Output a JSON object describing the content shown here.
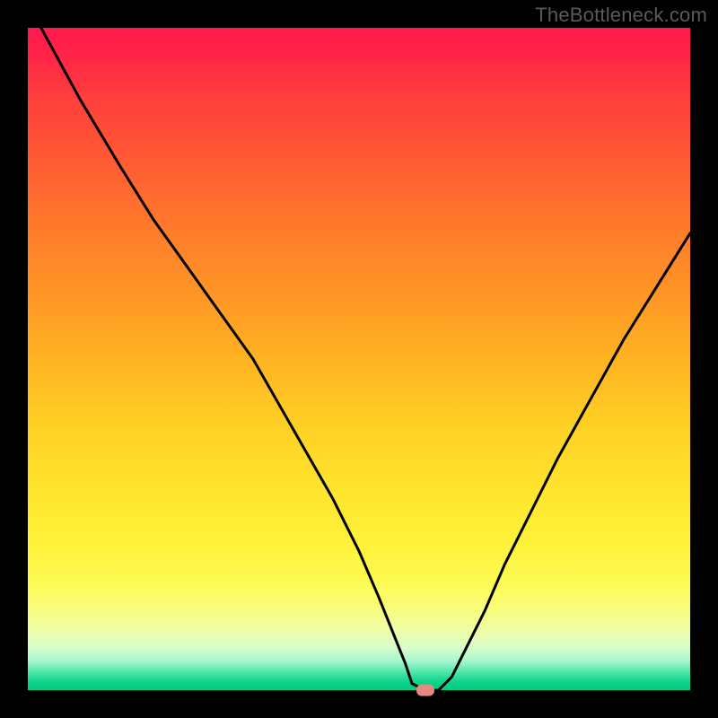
{
  "watermark": "TheBottleneck.com",
  "chart_data": {
    "type": "line",
    "title": "",
    "xlabel": "",
    "ylabel": "",
    "xlim": [
      0,
      100
    ],
    "ylim": [
      0,
      100
    ],
    "x": [
      2,
      8,
      14,
      19,
      24,
      29,
      34,
      38,
      42,
      46,
      50,
      53,
      55,
      57,
      58,
      60,
      62,
      64,
      66,
      69,
      72,
      76,
      80,
      85,
      90,
      95,
      100
    ],
    "y": [
      100,
      89,
      79,
      71,
      64,
      57,
      50,
      43,
      36,
      29,
      21,
      14,
      9,
      4,
      1,
      0,
      0,
      2,
      6,
      12,
      19,
      27,
      35,
      44,
      53,
      61,
      69
    ],
    "minimum_marker": {
      "x": 60,
      "y": 0
    },
    "gradient_stops": [
      {
        "pos": 0.0,
        "color": "#ff1a4d"
      },
      {
        "pos": 0.5,
        "color": "#ffb322"
      },
      {
        "pos": 0.85,
        "color": "#fdfb55"
      },
      {
        "pos": 1.0,
        "color": "#03cb81"
      }
    ],
    "description": "V-shaped bottleneck curve on red-to-green vertical gradient; minimum near x≈60 at y≈0."
  }
}
